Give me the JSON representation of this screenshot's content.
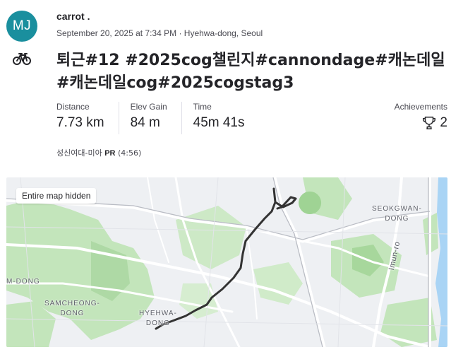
{
  "activity": {
    "avatar_initials": "MJ",
    "username": "carrot .",
    "meta": "September 20, 2025 at 7:34 PM · Hyehwa-dong, Seoul",
    "sport_icon": "bike-icon",
    "title": "퇴근#12 #2025cog챌린지#cannondage#캐논데일 #캐논데일cog#2025cogstag3"
  },
  "stats": {
    "distance_label": "Distance",
    "distance_value": "7.73 km",
    "elev_label": "Elev Gain",
    "elev_value": "84 m",
    "time_label": "Time",
    "time_value": "45m 41s",
    "achievements_label": "Achievements",
    "achievements_value": "2"
  },
  "segment": {
    "name": "성신여대-미아",
    "pr_label": "PR",
    "pr_time": "(4:56)"
  },
  "map": {
    "hidden_label": "Entire map hidden",
    "labels": {
      "seokgwan": "SEOKGWAN-\nDONG",
      "imun": "Imun-ro",
      "mdong": "M-DONG",
      "samcheong": "SAMCHEONG-\nDONG",
      "hyehwa": "HYEHWA-\nDONG"
    },
    "colors": {
      "green": "#bfe3b8",
      "road": "#ffffff",
      "route": "#333333",
      "water": "#a9d4f5"
    }
  }
}
